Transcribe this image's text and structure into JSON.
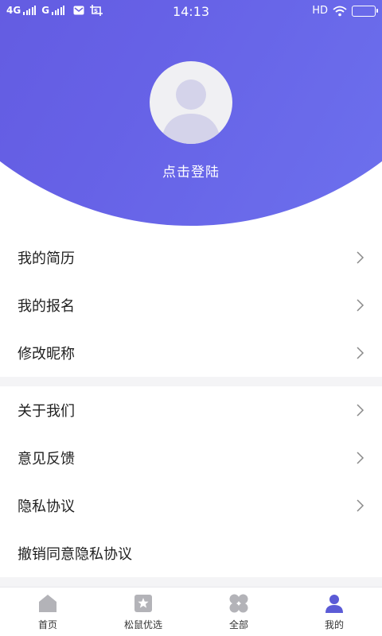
{
  "colors": {
    "accent": "#5d50d6",
    "tab_inactive": "#b3b3b8",
    "tab_active": "#5b5bd6"
  },
  "status_bar": {
    "network1": "4G",
    "network2": "G",
    "time": "14:13",
    "hd": "HD"
  },
  "profile": {
    "login_text": "点击登陆"
  },
  "menu_group1": [
    {
      "label": "我的简历"
    },
    {
      "label": "我的报名"
    },
    {
      "label": "修改昵称"
    }
  ],
  "menu_group2": [
    {
      "label": "关于我们"
    },
    {
      "label": "意见反馈"
    },
    {
      "label": "隐私协议"
    },
    {
      "label": "撤销同意隐私协议"
    }
  ],
  "tabs": [
    {
      "label": "首页",
      "icon": "home-icon"
    },
    {
      "label": "松鼠优选",
      "icon": "star-bookmark-icon"
    },
    {
      "label": "全部",
      "icon": "grid-icon"
    },
    {
      "label": "我的",
      "icon": "user-icon",
      "active": true
    }
  ]
}
